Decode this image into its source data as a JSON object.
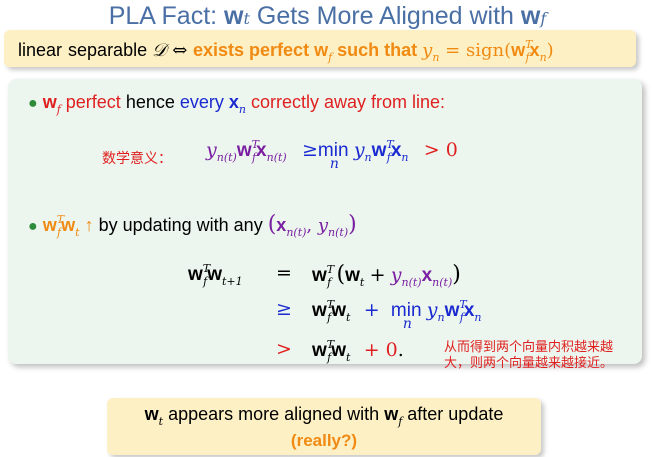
{
  "title": {
    "prefix": "PLA Fact: ",
    "w": "w",
    "t": "t",
    "middle": " Gets More Aligned with ",
    "f": "f"
  },
  "fact_box": {
    "linear": "linear",
    "separable": "separable ",
    "D": "𝒟",
    "iff": " ⇔ ",
    "exists": "exists perfect ",
    "such_that": " such that ",
    "formula": "y",
    "n": "n",
    "eq_sign": " = sign(",
    "T": "T",
    "x": "x",
    "close": ")"
  },
  "bullet1": {
    "w": "w",
    "f": "f",
    "perfect": " perfect",
    "hence": " hence ",
    "every": "every ",
    "xn": "x",
    "n": "n",
    "correctly": " correctly away from line:"
  },
  "annot1": "数学意义：",
  "eq1": {
    "y": "y",
    "nt": "n(t)",
    "w": "w",
    "f": "f",
    "T": "T",
    "x": "x",
    "geq": "≥",
    "min": "min",
    "n": "n",
    "gt": "> 0"
  },
  "bullet2": {
    "arrow": "↑",
    "by_updating": " by updating with any ",
    "t": "t",
    "lparen": "(",
    "comma": ", ",
    "rparen": ")"
  },
  "eqs": {
    "lhs_sub": "t+1",
    "op_eq": "=",
    "op_geq": "≥",
    "op_gt": ">",
    "plus": "+",
    "zero": "+ 0",
    "period": "."
  },
  "annot2_line1": "从而得到两个向量内积越来越",
  "annot2_line2": "大，则两个向量越来越接近。",
  "bottom": {
    "w": "w",
    "t": "t",
    "appears": " appears more aligned with ",
    "f": "f",
    "after": " after update",
    "really": "(really?)"
  }
}
